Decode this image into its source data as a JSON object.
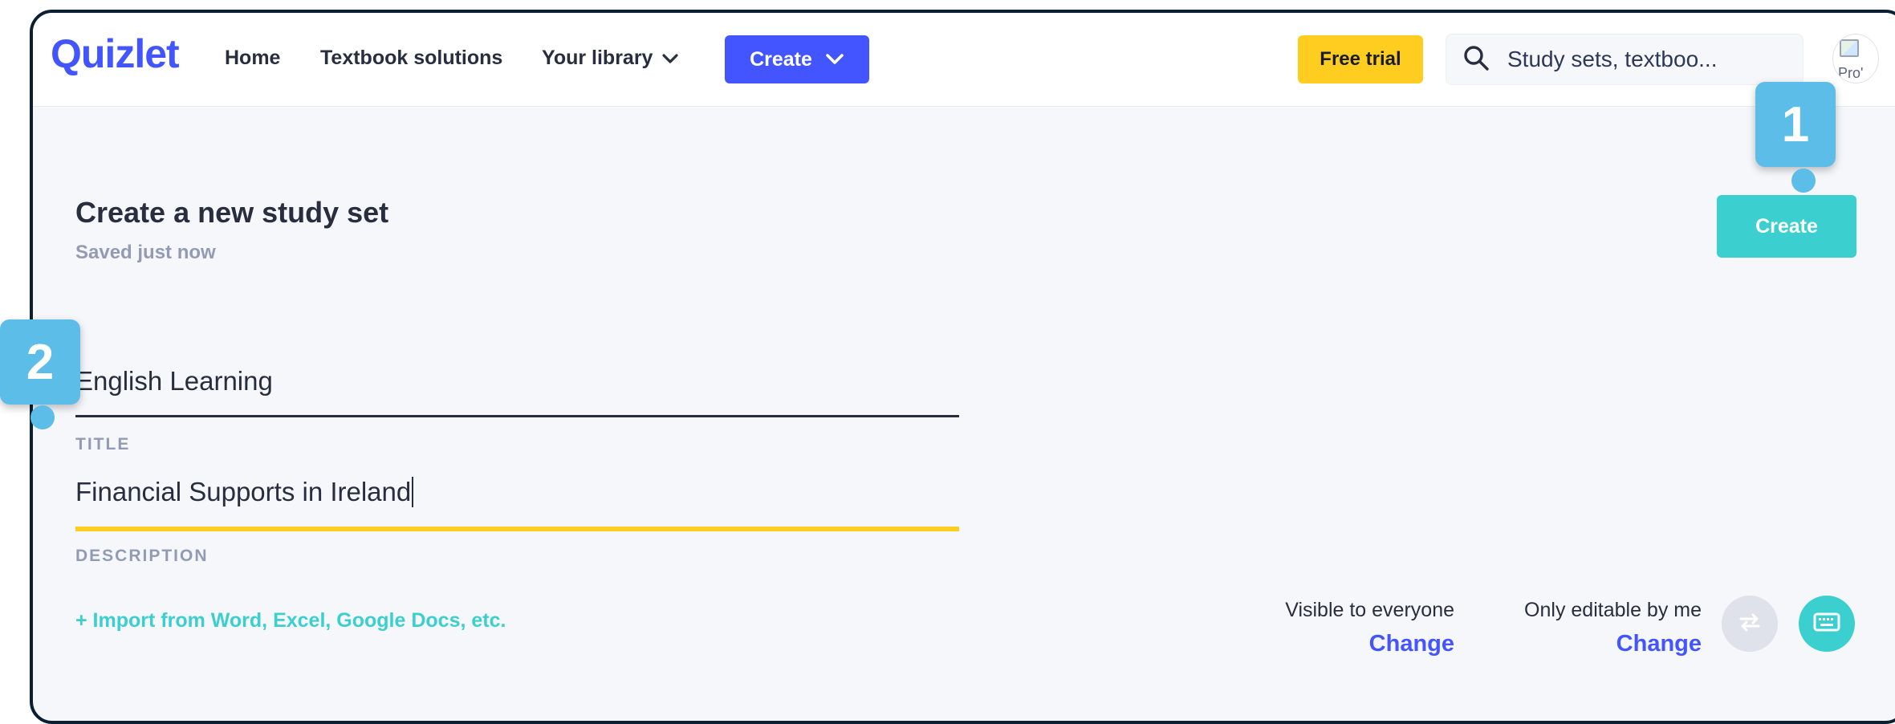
{
  "header": {
    "logo": "Quizlet",
    "nav": {
      "home": "Home",
      "textbook": "Textbook solutions",
      "library": "Your library"
    },
    "create_label": "Create",
    "free_trial_label": "Free trial",
    "search_placeholder": "Study sets, textboo...",
    "avatar_alt": "Pro'"
  },
  "page": {
    "title": "Create a new study set",
    "saved_status": "Saved just now",
    "create_button": "Create"
  },
  "form": {
    "title_value": "English Learning",
    "title_label": "TITLE",
    "description_value": "Financial Supports in Ireland",
    "description_label": "DESCRIPTION",
    "import_link": "+ Import from Word, Excel, Google Docs, etc."
  },
  "permissions": {
    "visibility_text": "Visible to everyone",
    "visibility_change": "Change",
    "edit_text": "Only editable by me",
    "edit_change": "Change"
  },
  "callouts": [
    "1",
    "2"
  ],
  "colors": {
    "brand_blue": "#4255ff",
    "teal": "#3ccfcf",
    "yellow": "#ffcd1f",
    "callout_blue": "#5bbde8"
  },
  "icons": [
    "chevron-down-icon",
    "search-icon",
    "swap-icon",
    "keyboard-icon"
  ]
}
